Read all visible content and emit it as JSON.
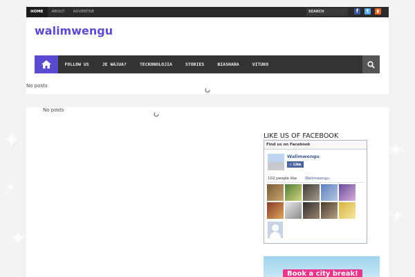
{
  "topnav": {
    "items": [
      "Home",
      "ABOUT",
      "ADVERTISE"
    ]
  },
  "search": {
    "placeholder": "SEARCH"
  },
  "social": {
    "icons": [
      "facebook-icon",
      "twitter-icon",
      "rss-icon"
    ]
  },
  "site": {
    "title": "walimwengu"
  },
  "mainnav": {
    "items": [
      "FOLLOW US",
      "JE WAJUA?",
      "TECKONOLOJIA",
      "STORIES",
      "BIASHARA",
      "VITUKO"
    ]
  },
  "content": {
    "no_posts_top": "No posts",
    "no_posts_main": "No posts"
  },
  "sidebar": {
    "title": "LIKE US OF FACEBOOK",
    "fb": {
      "header": "Find us on Facebook",
      "page_name": "Walimwengu",
      "like_label": "Like",
      "people_count": "102 people like",
      "people_link": "Walimwengu."
    },
    "ad_text": "Book a city break!"
  },
  "colors": {
    "accent": "#5a4bd1",
    "nav_bg": "#333333",
    "fb_blue": "#3b5998"
  }
}
